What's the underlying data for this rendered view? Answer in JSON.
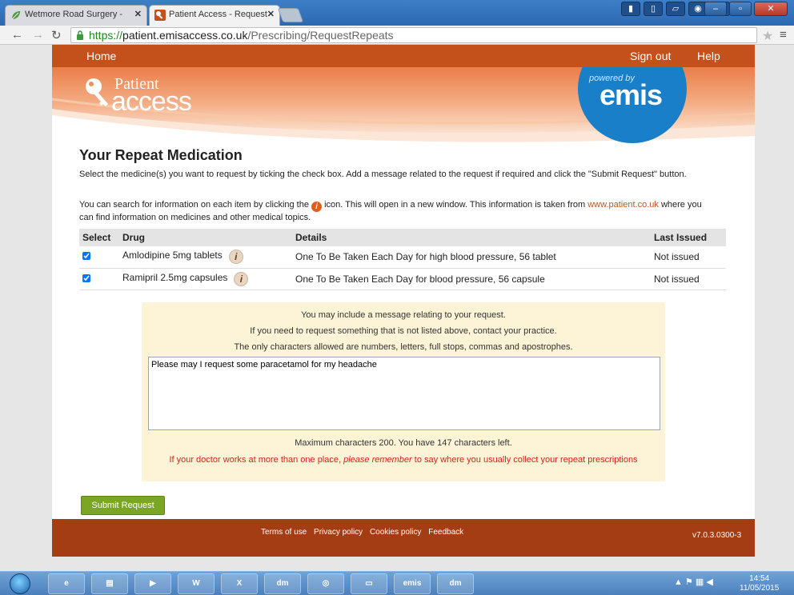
{
  "browser": {
    "tabs": [
      {
        "label": "Wetmore Road Surgery -",
        "active": false,
        "icon": "leaf-icon"
      },
      {
        "label": "Patient Access  - Request",
        "active": true,
        "icon": "patient-access-icon"
      }
    ],
    "tab_close_glyph": "✕",
    "url_scheme": "https://",
    "url_host": "patient.emisaccess.co.uk",
    "url_path": "/Prescribing/RequestRepeats"
  },
  "nav": {
    "home": "Home",
    "sign_out": "Sign out",
    "help": "Help"
  },
  "logo": {
    "word1": "Patient",
    "word2": "access",
    "powered_by": "powered by",
    "emis": "emis"
  },
  "main": {
    "title": "Your Repeat Medication",
    "intro1": "Select the medicine(s) you want to request by ticking the check box. Add a message related to the request if required and click the \"Submit Request\" button.",
    "intro2_a": "You can search for information on each item by clicking the ",
    "intro2_b": " icon. This will open in a new window. This information is taken from ",
    "intro2_link": "www.patient.co.uk",
    "intro2_c": " where you can find information on medicines and other medical topics.",
    "info_glyph": "i"
  },
  "table": {
    "headers": [
      "Select",
      "Drug",
      "Details",
      "Last Issued"
    ],
    "rows": [
      {
        "checked": true,
        "drug": "Amlodipine 5mg tablets",
        "details": "One To Be Taken Each Day for high blood pressure, 56 tablet",
        "last_issued": "Not issued"
      },
      {
        "checked": true,
        "drug": "Ramipril 2.5mg capsules",
        "details": "One To Be Taken Each Day for blood pressure, 56 capsule",
        "last_issued": "Not issued"
      }
    ]
  },
  "message": {
    "line1": "You may include a message relating to your request.",
    "line2": "If you need to request something that is not listed above, contact your practice.",
    "line3": "The only characters allowed are numbers, letters, full stops, commas and apostrophes.",
    "text": "Please may I request some paracetamol for my headache",
    "counter": "Maximum characters 200. You have 147 characters left.",
    "warn_a": "If your doctor works at more than one place, ",
    "warn_em": "please remember",
    "warn_b": " to say where you usually collect your repeat prescriptions"
  },
  "submit_label": "Submit Request",
  "footer": {
    "links": [
      "Terms of use",
      "Privacy policy",
      "Cookies policy",
      "Feedback"
    ],
    "version": "v7.0.3.0300-3"
  },
  "taskbar": {
    "apps": [
      "e",
      "▤",
      "▶",
      "W",
      "X",
      "dm",
      "◎",
      "▭",
      "emis Web",
      "dm"
    ],
    "time": "14:54",
    "date": "11/05/2015"
  },
  "colors": {
    "brand_orange": "#c4511b",
    "footer": "#a43d13",
    "emis_blue": "#1a7fc9",
    "submit_green": "#7aa623",
    "warning_red": "#d3251b"
  }
}
